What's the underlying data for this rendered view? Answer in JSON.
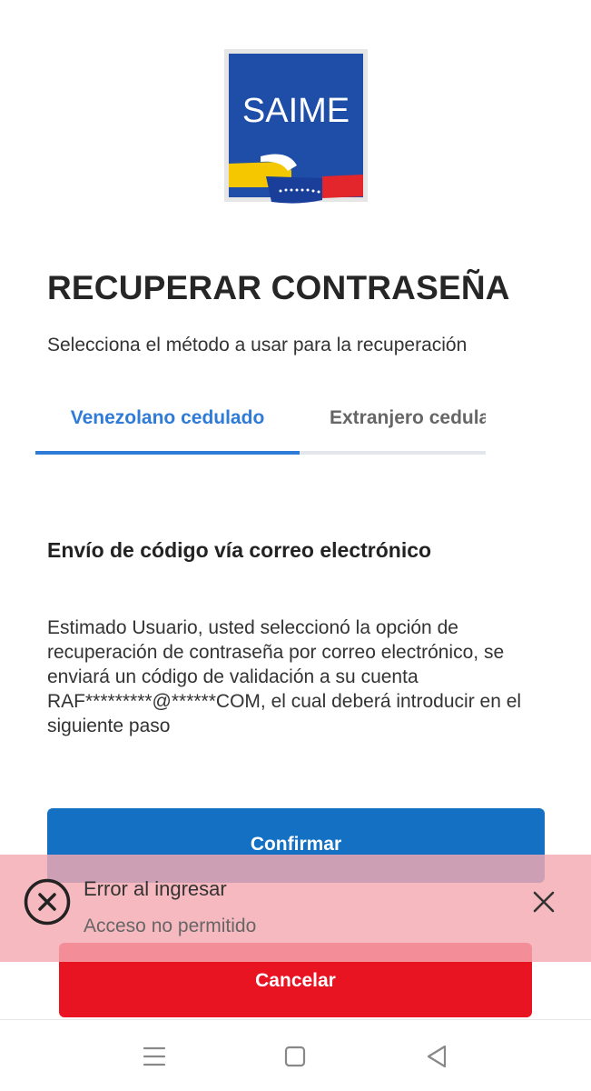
{
  "logo": {
    "text": "SAIME",
    "colors": {
      "blue": "#1e4ea8",
      "yellow": "#f4c700",
      "ribbon_blue": "#1a3f9a",
      "red": "#e3262b"
    }
  },
  "header": {
    "title": "RECUPERAR CONTRASEÑA",
    "subtitle": "Selecciona el método a usar para la recuperación"
  },
  "tabs": [
    {
      "label": "Venezolano cedulado",
      "active": true
    },
    {
      "label": "Extranjero cedulado",
      "active": false
    }
  ],
  "section": {
    "title": "Envío de código vía correo electrónico",
    "body": "Estimado Usuario, usted seleccionó la opción de recuperación de contraseña por correo electrónico, se enviará un código de validación a su cuenta RAF*********@******COM, el cual deberá introducir en el siguiente paso"
  },
  "buttons": {
    "confirm": "Confirmar",
    "cancel": "Cancelar"
  },
  "toast": {
    "title": "Error al ingresar",
    "message": "Acceso no permitido",
    "icon": "error-circle-x-icon",
    "close_icon": "close-icon"
  },
  "navbar": {
    "icons": [
      "menu-icon",
      "home-square-icon",
      "back-triangle-icon"
    ]
  },
  "colors": {
    "accent": "#2f7bd8",
    "confirm": "#1470c2",
    "cancel": "#e91422",
    "toast_bg": "#f5aab2"
  }
}
